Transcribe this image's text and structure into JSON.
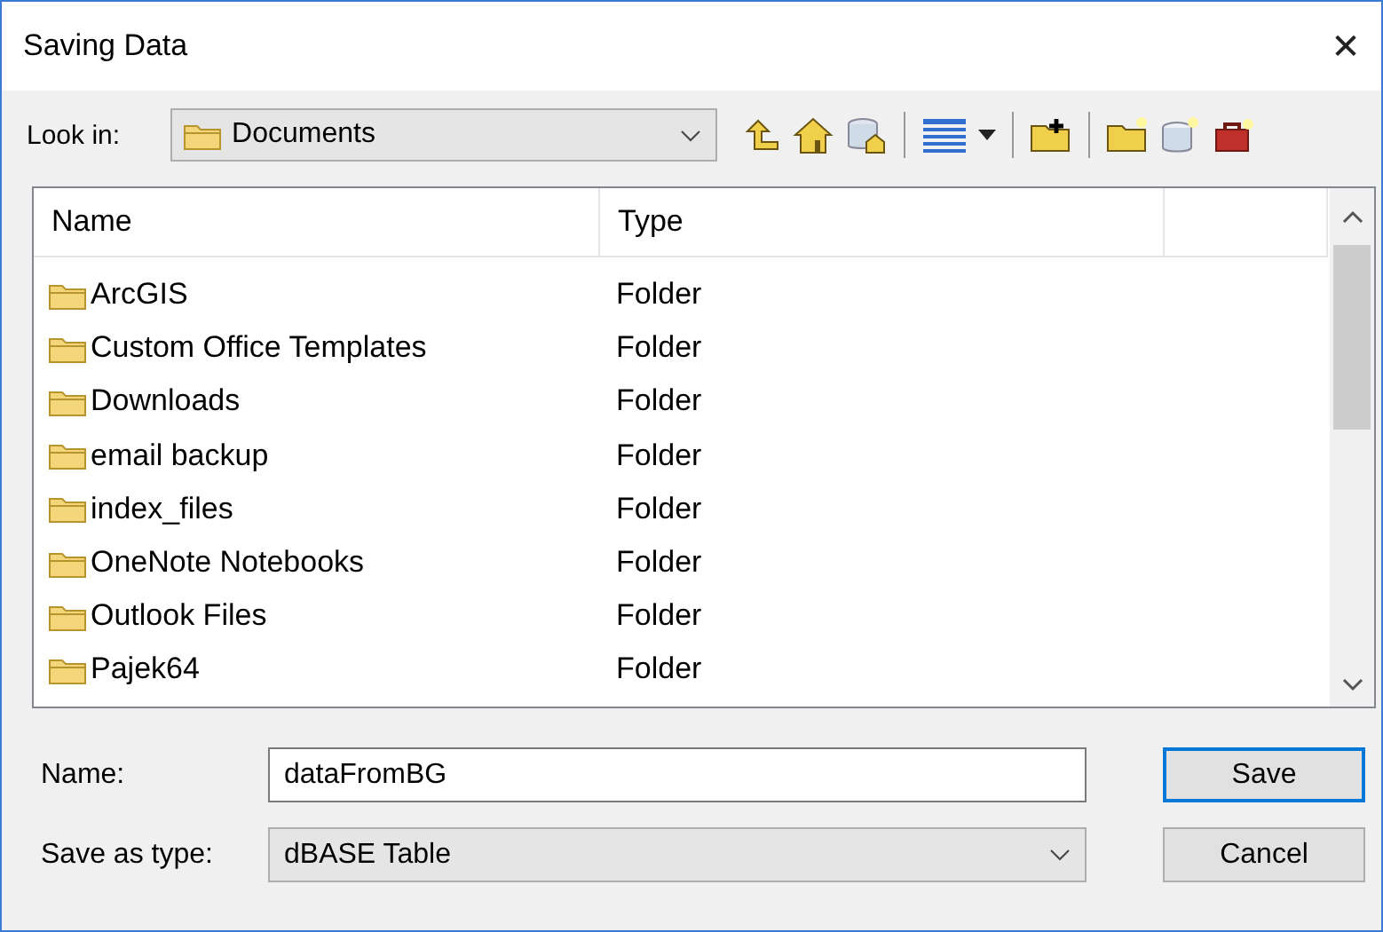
{
  "window": {
    "title": "Saving Data",
    "close": "✕"
  },
  "look_in": {
    "label": "Look in:",
    "value": "Documents"
  },
  "table": {
    "columns": [
      "Name",
      "Type"
    ],
    "rows": [
      {
        "name": "ArcGIS",
        "type": "Folder"
      },
      {
        "name": "Custom Office Templates",
        "type": "Folder"
      },
      {
        "name": "Downloads",
        "type": "Folder"
      },
      {
        "name": "email backup",
        "type": "Folder"
      },
      {
        "name": "index_files",
        "type": "Folder"
      },
      {
        "name": "OneNote Notebooks",
        "type": "Folder"
      },
      {
        "name": "Outlook Files",
        "type": "Folder"
      },
      {
        "name": "Pajek64",
        "type": "Folder"
      }
    ]
  },
  "name_field": {
    "label": "Name:",
    "value": "dataFromBG"
  },
  "type_field": {
    "label": "Save as type:",
    "value": "dBASE Table"
  },
  "buttons": [
    {
      "label": "Save",
      "kind": "default"
    },
    {
      "label": "Cancel",
      "kind": "normal"
    }
  ]
}
